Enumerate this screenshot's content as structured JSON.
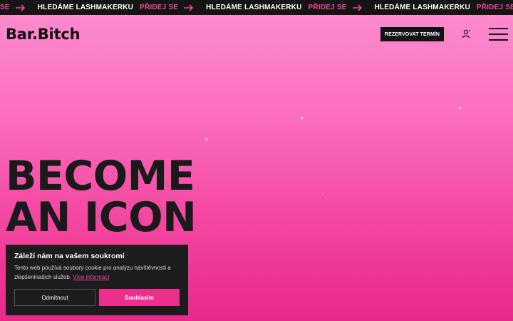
{
  "marquee": {
    "text": "HLEDÁME LASHMAKERKU",
    "cta": "PŘIDEJ SE",
    "lead_cta": "SE"
  },
  "header": {
    "logo": "Bar.Bitch",
    "reserve_button": "REZERVOVAT TERMÍN",
    "user_icon": "user-icon",
    "menu_icon": "hamburger-menu-icon"
  },
  "hero": {
    "line1": "BECOME",
    "line2": "AN ICON"
  },
  "cookie": {
    "title": "Záleží nám na vašem soukromí",
    "text": "Tento web používá soubory cookie pro analýzu návštěvnosti a zlepšeninašich služeb.",
    "link": "Více informací",
    "decline": "Odmítnout",
    "accept": "Souhlasím"
  },
  "colors": {
    "accent": "#f0449b",
    "dark": "#141414",
    "button_pink": "#ec2f8e"
  }
}
